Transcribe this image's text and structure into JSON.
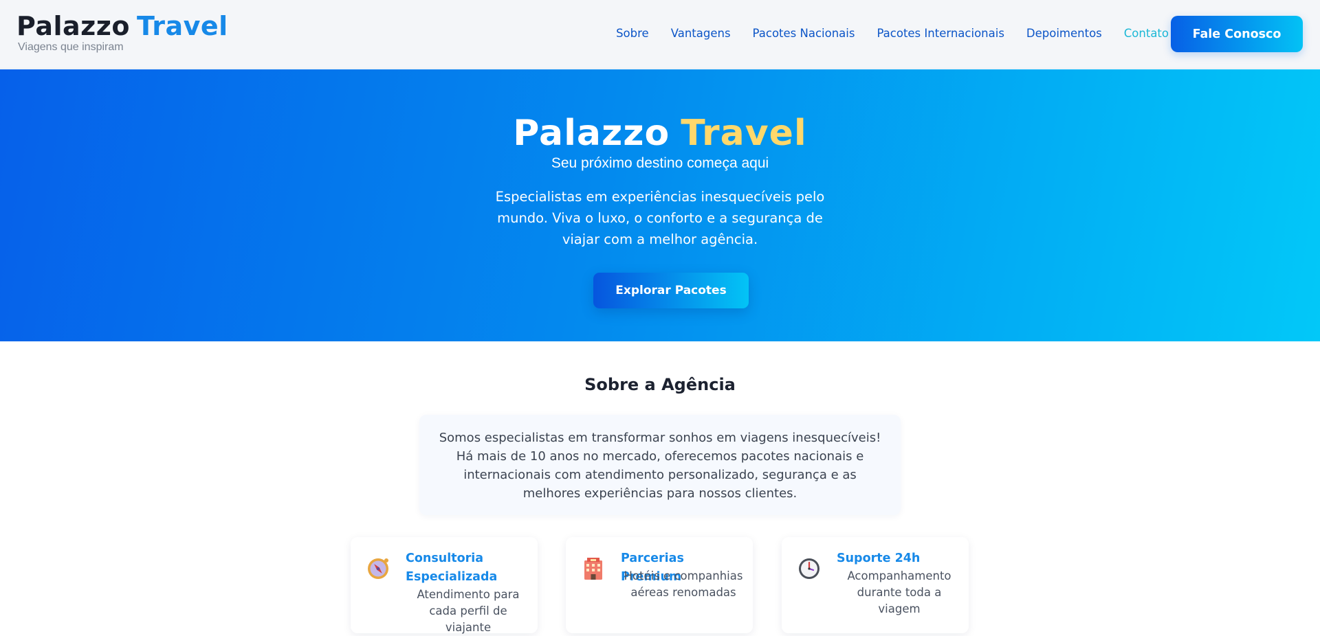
{
  "header": {
    "brand_word1": "Palazzo",
    "brand_word2": "Travel",
    "tagline": "Viagens que inspiram",
    "nav": [
      "Sobre",
      "Vantagens",
      "Pacotes Nacionais",
      "Pacotes Internacionais",
      "Depoimentos",
      "Contato"
    ],
    "active_nav": "Contato",
    "cta_label": "Fale Conosco"
  },
  "hero": {
    "title_word1": "Palazzo",
    "title_word2": "Travel",
    "subtitle": "Seu próximo destino começa aqui",
    "description": "Especialistas em experiências inesquecíveis pelo mundo. Viva o luxo, o conforto e a segurança de viajar com a melhor agência.",
    "button_label": "Explorar Pacotes"
  },
  "about": {
    "title": "Sobre a Agência",
    "text": "Somos especialistas em transformar sonhos em viagens inesquecíveis! Há mais de 10 anos no mercado, oferecemos pacotes nacionais e internacionais com atendimento personalizado, segurança e as melhores experiências para nossos clientes."
  },
  "features": [
    {
      "icon": "compass-icon",
      "title": "Consultoria Especializada",
      "description": "Atendimento para cada perfil de viajante"
    },
    {
      "icon": "hotel-icon",
      "title": "Parcerias Premium",
      "description": "Hotéis e companhias aéreas renomadas"
    },
    {
      "icon": "clock-icon",
      "title": "Suporte 24h",
      "description": "Acompanhamento durante toda a viagem"
    }
  ],
  "colors": {
    "brand_blue": "#1789e8",
    "nav_blue": "#0c55c7",
    "nav_active": "#1cb8d6",
    "hero_gradient_start": "#0660ea",
    "hero_gradient_end": "#02c8f8",
    "gold": "#ffd86b"
  }
}
